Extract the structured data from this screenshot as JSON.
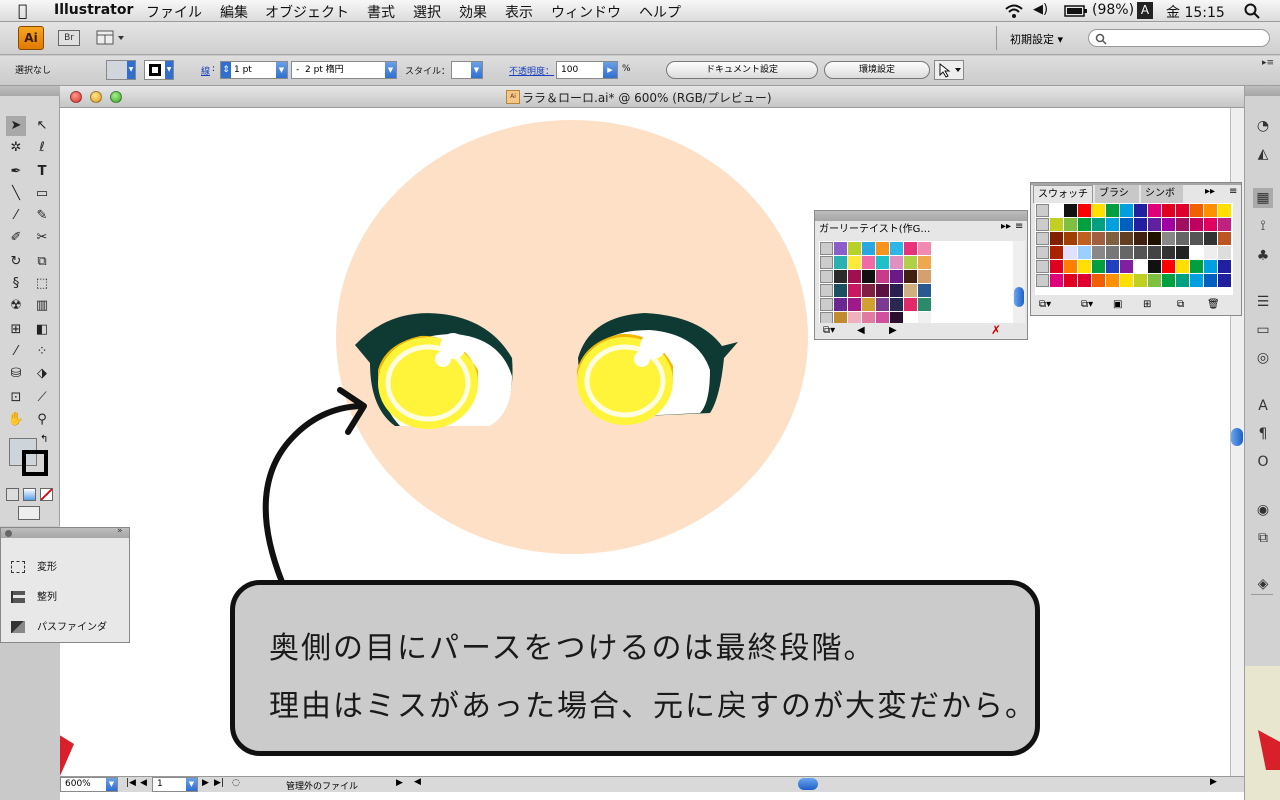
{
  "menubar": {
    "apple": "",
    "app_name": "Illustrator",
    "items": [
      "ファイル",
      "編集",
      "オブジェクト",
      "書式",
      "選択",
      "効果",
      "表示",
      "ウィンドウ",
      "ヘルプ"
    ],
    "battery": "(98%)",
    "input_method": "A",
    "clock": "金 15:15"
  },
  "appbar": {
    "ai_logo": "Ai",
    "bridge": "Br",
    "workspace": "初期設定",
    "search_placeholder": ""
  },
  "control": {
    "selection": "選択なし",
    "stroke_label": "線",
    "stroke_value": "1 pt",
    "brush_value": "2 pt 楕円",
    "style_label": "スタイル：",
    "opacity_label": "不透明度：",
    "opacity_value": "100",
    "percent": "%",
    "doc_settings": "ドキュメント設定",
    "preferences": "環境設定"
  },
  "document": {
    "title": "ララ＆ローロ.ai* @ 600% (RGB/プレビュー)",
    "caption_line1": "奥側の目にパースをつけるのは最終段階。",
    "caption_line2": "理由はミスがあった場合、元に戻すのが大変だから。"
  },
  "gurly_panel": {
    "title": "ガーリーテイスト(作G…"
  },
  "swatch_panel": {
    "tabs": [
      "スウォッチ",
      "ブラシ",
      "シンボ"
    ]
  },
  "flyout": {
    "items": [
      "変形",
      "整列",
      "パスファインダ"
    ]
  },
  "status": {
    "zoom": "600%",
    "page": "1",
    "file_status": "管理外のファイル"
  },
  "colors": {
    "face": "#fde0c6",
    "eye_outline": "#0f3a33",
    "iris_dark": "#f4b600",
    "iris_light": "#fff43a",
    "caption_bg": "#cbcbcb"
  }
}
